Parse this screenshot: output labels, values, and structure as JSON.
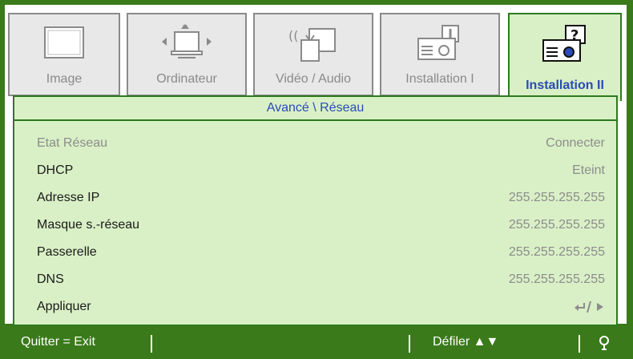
{
  "tabs": [
    {
      "label": "Image",
      "icon": "monitor-icon",
      "active": false
    },
    {
      "label": "Ordinateur",
      "icon": "computer-icon",
      "active": false
    },
    {
      "label": "Vidéo / Audio",
      "icon": "video-audio-icon",
      "active": false
    },
    {
      "label": "Installation I",
      "icon": "projector-icon",
      "active": false
    },
    {
      "label": "Installation II",
      "icon": "projector-help-icon",
      "active": true
    }
  ],
  "breadcrumb": "Avancé \\ Réseau",
  "rows": [
    {
      "name": "Etat Réseau",
      "value": "Connecter",
      "disabled": true
    },
    {
      "name": "DHCP",
      "value": "Eteint",
      "disabled": false
    },
    {
      "name": "Adresse IP",
      "value": "255.255.255.255",
      "disabled": false
    },
    {
      "name": "Masque s.-réseau",
      "value": "255.255.255.255",
      "disabled": false
    },
    {
      "name": "Passerelle",
      "value": "255.255.255.255",
      "disabled": false
    },
    {
      "name": "DNS",
      "value": "255.255.255.255",
      "disabled": false
    },
    {
      "name": "Appliquer",
      "value": "enter-arrow-icon",
      "disabled": false
    }
  ],
  "statusbar": {
    "quit": "Quitter = Exit",
    "scroll": "Défiler ▲▼",
    "hint_icon": "bulb-icon"
  },
  "colors": {
    "frame_green": "#3a7a1a",
    "panel_green": "#d9f0c6",
    "accent_blue": "#2a4bb8",
    "disabled_gray": "#8c8c8c"
  }
}
